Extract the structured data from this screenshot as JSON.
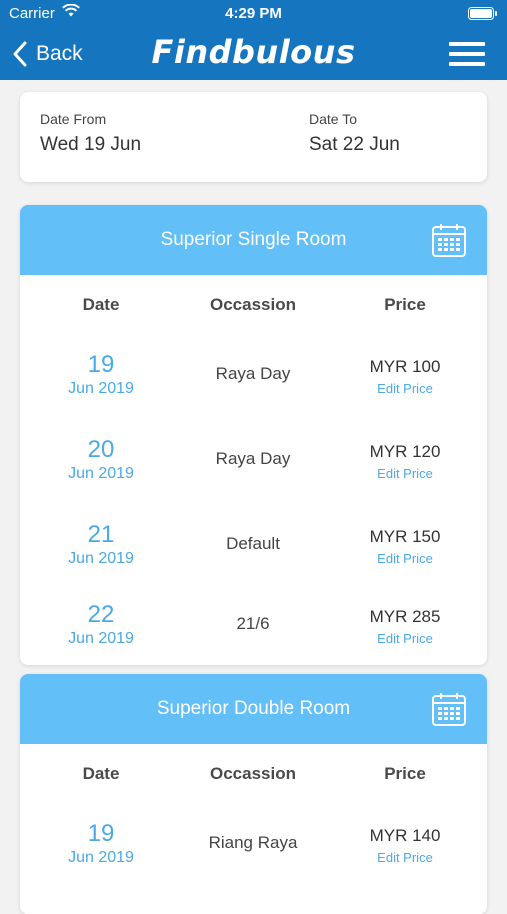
{
  "status_bar": {
    "carrier": "Carrier",
    "time": "4:29 PM"
  },
  "nav": {
    "back_label": "Back",
    "logo": "Findbulous"
  },
  "colors": {
    "header": "#1576bf",
    "accent": "#62bff8",
    "link": "#4aa9e6"
  },
  "date_range": {
    "from_label": "Date From",
    "from_value": "Wed 19 Jun",
    "to_label": "Date To",
    "to_value": "Sat 22 Jun"
  },
  "columns": {
    "date": "Date",
    "occasion": "Occassion",
    "price": "Price"
  },
  "rooms": [
    {
      "title": "Superior Single Room",
      "rows": [
        {
          "day": "19",
          "month": "Jun 2019",
          "occasion": "Raya Day",
          "price": "MYR 100",
          "edit": "Edit Price"
        },
        {
          "day": "20",
          "month": "Jun 2019",
          "occasion": "Raya Day",
          "price": "MYR 120",
          "edit": "Edit Price"
        },
        {
          "day": "21",
          "month": "Jun 2019",
          "occasion": "Default",
          "price": "MYR 150",
          "edit": "Edit Price"
        },
        {
          "day": "22",
          "month": "Jun 2019",
          "occasion": "21/6",
          "price": "MYR 285",
          "edit": "Edit Price"
        }
      ]
    },
    {
      "title": "Superior Double Room",
      "rows": [
        {
          "day": "19",
          "month": "Jun 2019",
          "occasion": "Riang Raya",
          "price": "MYR 140",
          "edit": "Edit Price"
        }
      ]
    }
  ]
}
